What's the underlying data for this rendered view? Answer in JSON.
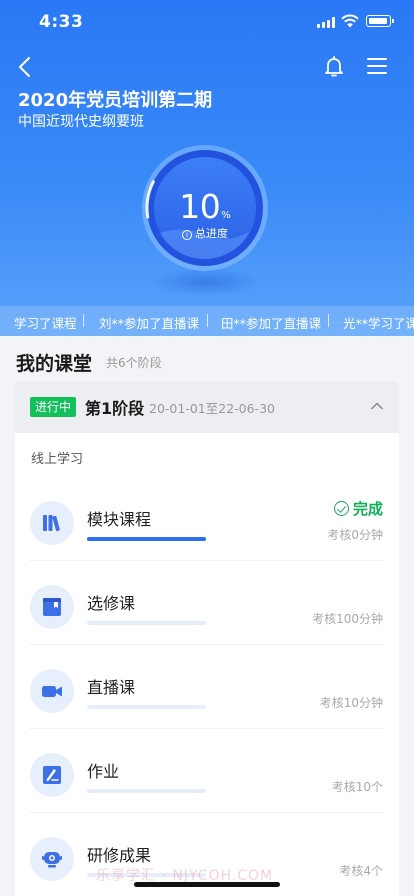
{
  "status_bar": {
    "time": "4:33"
  },
  "header": {
    "title": "2020年党员培训第二期",
    "subtitle": "中国近现代史纲要班",
    "icons": {
      "back": "back-chevron-icon",
      "bell": "bell-icon",
      "menu": "menu-icon"
    }
  },
  "progress": {
    "value": 10,
    "number_text": "10",
    "unit": "%",
    "label": "总进度",
    "info_icon": "i"
  },
  "ticker": [
    "学习了课程",
    "刘**参加了直播课",
    "田**参加了直播课",
    "光**学习了课"
  ],
  "classroom": {
    "title": "我的课堂",
    "count": "共6个阶段"
  },
  "stage": {
    "badge": "进行中",
    "name": "第1阶段",
    "dates": "20-01-01至22-06-30"
  },
  "online": {
    "label": "线上学习"
  },
  "courses": [
    {
      "name": "模块课程",
      "requirement": "考核0分钟",
      "status": "完成",
      "progress": 1.0,
      "icon": "books-icon"
    },
    {
      "name": "选修课",
      "requirement": "考核100分钟",
      "progress": 0,
      "icon": "elective-book-icon"
    },
    {
      "name": "直播课",
      "requirement": "考核10分钟",
      "progress": 0,
      "icon": "video-camera-icon"
    },
    {
      "name": "作业",
      "requirement": "考核10个",
      "progress": 0,
      "icon": "homework-pencil-icon"
    },
    {
      "name": "研修成果",
      "requirement": "考核4个",
      "progress": 0,
      "icon": "robot-icon"
    }
  ],
  "watermark": "乐享学汇 · NJYCOH.COM",
  "colors": {
    "primary": "#2a78f5",
    "progress_fill": "#2d6ef0",
    "success": "#13c05c"
  }
}
